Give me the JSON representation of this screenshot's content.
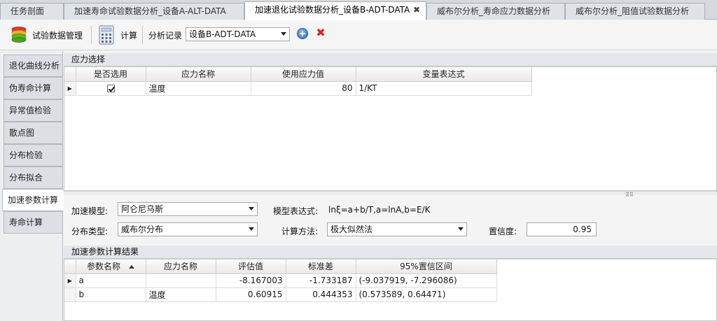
{
  "tabs": [
    {
      "label": "任务剖面"
    },
    {
      "label": "加速寿命试验数据分析_设备A-ALT-DATA"
    },
    {
      "label": "加速退化试验数据分析_设备B-ADT-DATA",
      "close": "✖"
    },
    {
      "label": "威布尔分析_寿命应力数据分析"
    },
    {
      "label": "威布尔分析_阻值试验数据分析"
    }
  ],
  "toolbar": {
    "data_mgmt_label": "试验数据管理",
    "calc_label": "计算",
    "record_label": "分析记录",
    "record_value": "设备B-ADT-DATA",
    "add_icon": "add-icon",
    "delete_icon": "delete-icon",
    "delete_glyph": "✖"
  },
  "nav": [
    {
      "label": "退化曲线分析"
    },
    {
      "label": "伪寿命计算"
    },
    {
      "label": "异常值检验"
    },
    {
      "label": "散点图"
    },
    {
      "label": "分布检验"
    },
    {
      "label": "分布拟合"
    },
    {
      "label": "加速参数计算"
    },
    {
      "label": "寿命计算"
    }
  ],
  "stress": {
    "title": "应力选择",
    "columns": [
      "是否选用",
      "应力名称",
      "使用应力值",
      "变量表达式"
    ],
    "rows": [
      {
        "marker": "▶",
        "selected": true,
        "name": "温度",
        "value": "80",
        "expr": "1/KT"
      }
    ]
  },
  "form": {
    "model_label": "加速模型:",
    "model_value": "阿仑尼乌斯",
    "expr_label": "模型表达式:",
    "expr_value": "lnξ=a+b/T,a=lnA,b=E/K",
    "dist_label": "分布类型:",
    "dist_value": "威布尔分布",
    "method_label": "计算方法:",
    "method_value": "极大似然法",
    "confidence_label": "置信度:",
    "confidence_value": "0.95"
  },
  "results": {
    "title": "加速参数计算结果",
    "columns": [
      "参数名称",
      "应力名称",
      "评估值",
      "标准差",
      "95%置信区间"
    ],
    "rows": [
      {
        "marker": "▶",
        "param": "a",
        "stress": "",
        "estimate": "-8.167003",
        "stddev": "-1.733187",
        "ci": "(-9.037919, -7.296086)"
      },
      {
        "marker": "",
        "param": "b",
        "stress": "温度",
        "estimate": "0.60915",
        "stddev": "0.444353",
        "ci": "(0.573589, 0.64471)"
      }
    ]
  },
  "splitter_grip": "⠿⠿"
}
